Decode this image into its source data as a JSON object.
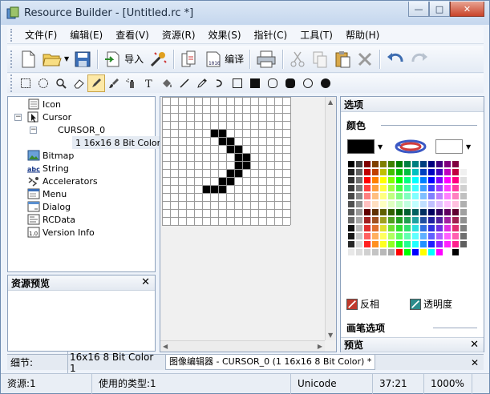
{
  "window": {
    "title": "Resource Builder - [Untitled.rc *]"
  },
  "caption_buttons": {
    "minimize": "—",
    "maximize": "□",
    "close": "✕"
  },
  "menu": [
    "文件(F)",
    "编辑(E)",
    "查看(V)",
    "资源(R)",
    "效果(S)",
    "指针(C)",
    "工具(T)",
    "帮助(H)"
  ],
  "toolbar": {
    "import_label": "导入",
    "compile_label": "编译"
  },
  "tree": {
    "items": [
      {
        "label": "Icon",
        "icon": "icon-resource-icon"
      },
      {
        "label": "Cursor",
        "icon": "cursor-resource-icon"
      },
      {
        "label": "CURSOR_0"
      },
      {
        "label": "1 16x16 8 Bit Color"
      },
      {
        "label": "Bitmap",
        "icon": "bitmap-resource-icon"
      },
      {
        "label": "String",
        "icon": "string-resource-icon"
      },
      {
        "label": "Accelerators",
        "icon": "accelerators-resource-icon"
      },
      {
        "label": "Menu",
        "icon": "menu-resource-icon"
      },
      {
        "label": "Dialog",
        "icon": "dialog-resource-icon"
      },
      {
        "label": "RCData",
        "icon": "rcdata-resource-icon"
      },
      {
        "label": "Version Info",
        "icon": "versioninfo-resource-icon"
      }
    ],
    "expand_collapse": "−"
  },
  "preview_panel": {
    "title": "资源预览",
    "close": "✕"
  },
  "options_panel": {
    "header": "选项",
    "color_section": "颜色",
    "invert_label": "反相",
    "transparency_label": "透明度",
    "brush_section": "画笔选项",
    "preview_section": "预览",
    "preview_close": "✕",
    "foreground_color": "#000000",
    "background_color": "#ffffff"
  },
  "tabs": {
    "details_label": "细节:",
    "details_value": "16x16 8 Bit Color 1",
    "editor_tab": "图像编辑器 - CURSOR_0 (1 16x16 8 Bit Color) *",
    "close": "✕"
  },
  "status": {
    "resources": "资源:1",
    "types_used": "使用的类型:1",
    "encoding": "Unicode",
    "position": "37:21",
    "zoom": "1000%"
  },
  "cursor_image": {
    "size": 16,
    "pixels": [
      [
        6,
        4
      ],
      [
        7,
        4
      ],
      [
        7,
        5
      ],
      [
        8,
        5
      ],
      [
        8,
        6
      ],
      [
        9,
        6
      ],
      [
        9,
        7
      ],
      [
        10,
        7
      ],
      [
        9,
        8
      ],
      [
        10,
        8
      ],
      [
        8,
        9
      ],
      [
        9,
        9
      ],
      [
        7,
        10
      ],
      [
        8,
        10
      ],
      [
        5,
        11
      ],
      [
        6,
        11
      ],
      [
        7,
        11
      ]
    ]
  },
  "palette_colors": [
    "#000000",
    "#404040",
    "#800000",
    "#804000",
    "#808000",
    "#408000",
    "#008000",
    "#008040",
    "#008080",
    "#004080",
    "#000080",
    "#400080",
    "#800080",
    "#800040",
    "#ffffff",
    "#202020",
    "#606060",
    "#c00000",
    "#c04000",
    "#c0c000",
    "#40c000",
    "#00c000",
    "#00c040",
    "#00c0c0",
    "#0040c0",
    "#0000c0",
    "#4000c0",
    "#c000c0",
    "#c00040",
    "#f0f0f0",
    "#303030",
    "#707070",
    "#ff0000",
    "#ff8000",
    "#ffff00",
    "#80ff00",
    "#00ff00",
    "#00ff80",
    "#00ffff",
    "#0080ff",
    "#0000ff",
    "#8000ff",
    "#ff00ff",
    "#ff0080",
    "#e0e0e0",
    "#383838",
    "#787878",
    "#ff4040",
    "#ff9f40",
    "#ffff40",
    "#9fff40",
    "#40ff40",
    "#40ff9f",
    "#40ffff",
    "#409fff",
    "#4040ff",
    "#9f40ff",
    "#ff40ff",
    "#ff409f",
    "#d0d0d0",
    "#484848",
    "#888888",
    "#ff8080",
    "#ffbf80",
    "#ffff80",
    "#bfff80",
    "#80ff80",
    "#80ffbf",
    "#80ffff",
    "#80bfff",
    "#8080ff",
    "#bf80ff",
    "#ff80ff",
    "#ff80bf",
    "#c0c0c0",
    "#505050",
    "#909090",
    "#ffc0c0",
    "#ffdfc0",
    "#ffffc0",
    "#dfffc0",
    "#c0ffc0",
    "#c0ffdf",
    "#c0ffff",
    "#c0dfff",
    "#c0c0ff",
    "#dfc0ff",
    "#ffc0ff",
    "#ffc0df",
    "#b0b0b0",
    "#585858",
    "#989898",
    "#600000",
    "#603000",
    "#606000",
    "#306000",
    "#006000",
    "#006030",
    "#006060",
    "#003060",
    "#000060",
    "#300060",
    "#600060",
    "#600030",
    "#a0a0a0",
    "#686868",
    "#a8a8a8",
    "#a02020",
    "#a05020",
    "#a0a020",
    "#50a020",
    "#20a020",
    "#20a050",
    "#20a0a0",
    "#2050a0",
    "#2020a0",
    "#5020a0",
    "#a020a0",
    "#a02050",
    "#909090",
    "#101010",
    "#b8b8b8",
    "#e03030",
    "#e07030",
    "#e0e030",
    "#70e030",
    "#30e030",
    "#30e070",
    "#30e0e0",
    "#3070e0",
    "#3030e0",
    "#7030e0",
    "#e030e0",
    "#e03070",
    "#808080",
    "#181818",
    "#c8c8c8",
    "#ff6060",
    "#ffb060",
    "#ffff60",
    "#b0ff60",
    "#60ff60",
    "#60ffb0",
    "#60ffff",
    "#60b0ff",
    "#6060ff",
    "#b060ff",
    "#ff60ff",
    "#ff60b0",
    "#707070",
    "#282828",
    "#d8d8d8",
    "#ff2020",
    "#ff9020",
    "#ffff20",
    "#90ff20",
    "#20ff20",
    "#20ff90",
    "#20ffff",
    "#2090ff",
    "#2020ff",
    "#9020ff",
    "#ff20ff",
    "#ff2090",
    "#606060",
    "#e8e8e8",
    "#dddddd",
    "#d0d0d0",
    "#c4c4c4",
    "#b8b8b8",
    "#a8a8a8",
    "#ff0000",
    "#00ff00",
    "#0000ff",
    "#ffff00",
    "#00ffff",
    "#ff00ff",
    "#ffffff",
    "#000000",
    "#ffffff"
  ]
}
